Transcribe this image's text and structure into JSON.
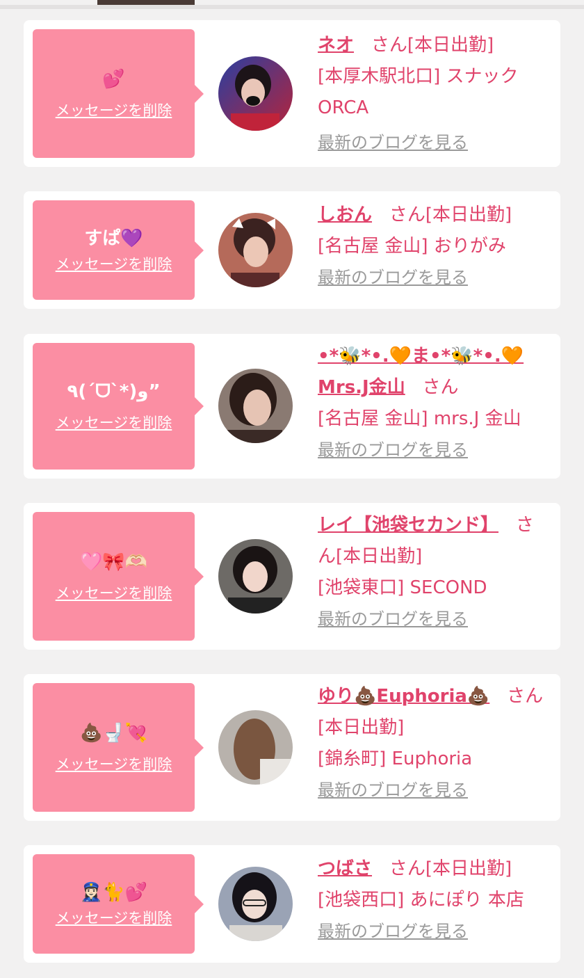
{
  "cards": [
    {
      "message": "💕",
      "delete_label": "メッセージを削除",
      "name": "ネオ",
      "san": "さん",
      "status": "[本日出勤]",
      "shop": "[本厚木駅北口] スナック ORCA",
      "blog_label": "最新のブログを見る"
    },
    {
      "message": "すぱ💜",
      "delete_label": "メッセージを削除",
      "name": "しおん",
      "san": "さん",
      "status": "[本日出勤]",
      "shop": "[名古屋 金山] おりがみ",
      "blog_label": "最新のブログを見る"
    },
    {
      "message": "٩(ˊᗜˋ*)و”",
      "delete_label": "メッセージを削除",
      "name": "•*🐝*•.🧡ま•*🐝*•.🧡 Mrs.J金山",
      "san": "さん",
      "status": "",
      "shop": "[名古屋 金山] mrs.J 金山",
      "blog_label": "最新のブログを見る"
    },
    {
      "message": "🩷🎀🫶🏻",
      "delete_label": "メッセージを削除",
      "name": "レイ【池袋セカンド】",
      "san": "さん",
      "status": "[本日出勤]",
      "shop": "[池袋東口] SECOND",
      "blog_label": "最新のブログを見る"
    },
    {
      "message": "💩🚽💘",
      "delete_label": "メッセージを削除",
      "name": "ゆり💩Euphoria💩",
      "san": "さん",
      "status": "[本日出勤]",
      "shop": "[錦糸町] Euphoria",
      "blog_label": "最新のブログを見る"
    },
    {
      "message": "👮🏻‍♀️🐈💕",
      "delete_label": "メッセージを削除",
      "name": "つばさ",
      "san": "さん",
      "status": "[本日出勤]",
      "shop": "[池袋西口] あにぽり 本店",
      "blog_label": "最新のブログを見る"
    }
  ],
  "colors": {
    "accent": "#e0436b",
    "bubble": "#fb8ea3",
    "link_gray": "#9a9a9a",
    "background": "#f2f1f1"
  }
}
